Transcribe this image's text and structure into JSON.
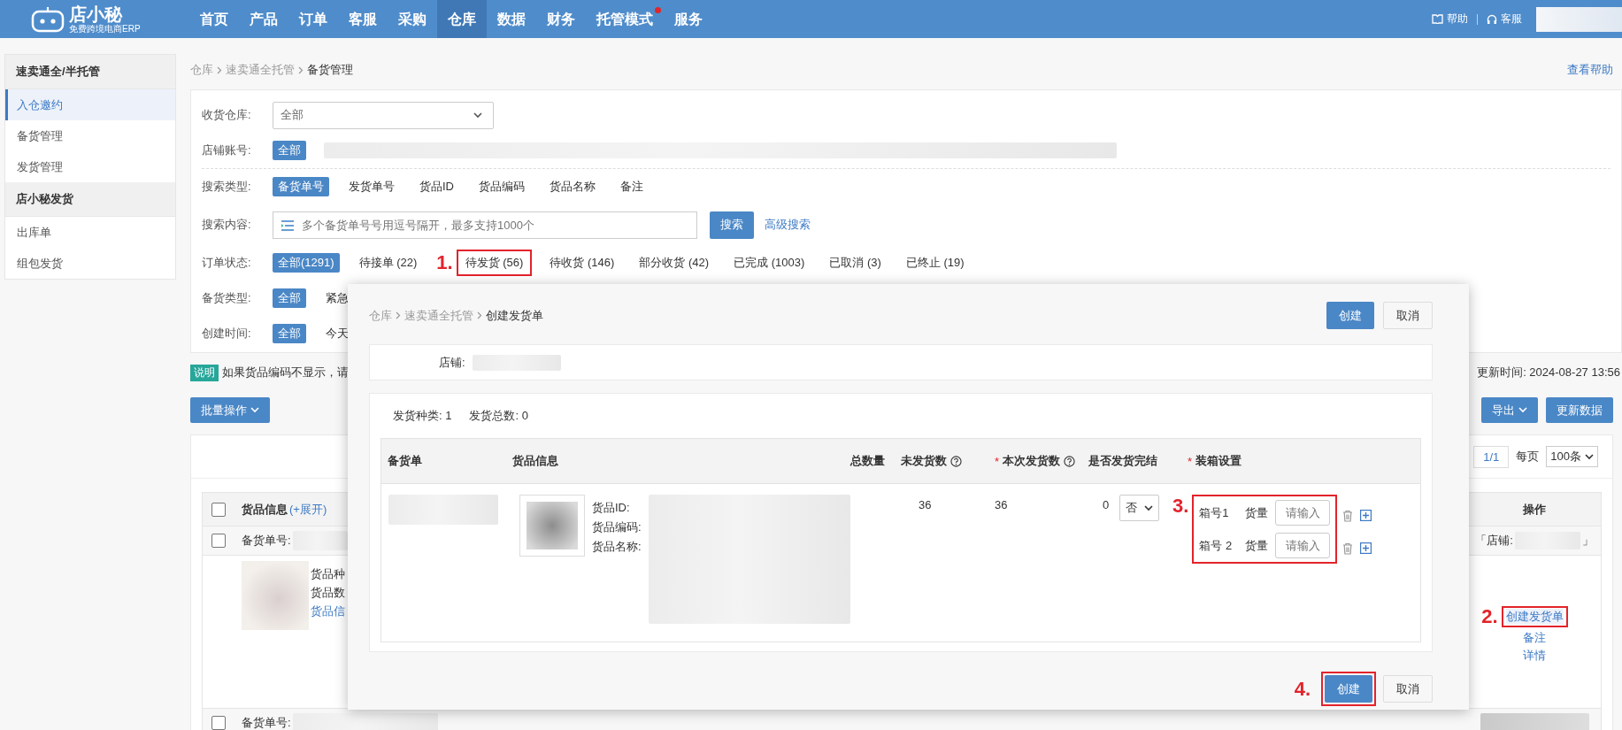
{
  "nav": {
    "brand": "店小秘",
    "brand_sub": "免费跨境电商ERP",
    "items": [
      {
        "label": "首页",
        "selected": false,
        "badge": false
      },
      {
        "label": "产品",
        "selected": false,
        "badge": false
      },
      {
        "label": "订单",
        "selected": false,
        "badge": false
      },
      {
        "label": "客服",
        "selected": false,
        "badge": false
      },
      {
        "label": "采购",
        "selected": false,
        "badge": false
      },
      {
        "label": "仓库",
        "selected": true,
        "badge": false
      },
      {
        "label": "数据",
        "selected": false,
        "badge": false
      },
      {
        "label": "财务",
        "selected": false,
        "badge": false
      },
      {
        "label": "托管模式",
        "selected": false,
        "badge": true
      },
      {
        "label": "服务",
        "selected": false,
        "badge": false
      }
    ],
    "help": "帮助",
    "service": "客服"
  },
  "sidebar": {
    "groups": [
      {
        "title": "速卖通全/半托管",
        "items": [
          {
            "label": "入仓邀约",
            "selected": true
          },
          {
            "label": "备货管理",
            "selected": false
          },
          {
            "label": "发货管理",
            "selected": false
          }
        ]
      },
      {
        "title": "店小秘发货",
        "items": [
          {
            "label": "出库单",
            "selected": false
          },
          {
            "label": "组包发货",
            "selected": false
          }
        ]
      }
    ]
  },
  "breadcrumb": [
    "仓库",
    "速卖通全托管",
    "备货管理"
  ],
  "help_link": "查看帮助",
  "filters": [
    {
      "kind": "select",
      "label": "收货仓库:",
      "value": "全部"
    },
    {
      "kind": "chips",
      "label": "店铺账号:",
      "redacted": true,
      "options": [
        {
          "label": "全部",
          "selected": true
        }
      ]
    },
    {
      "kind": "divider"
    },
    {
      "kind": "chips",
      "label": "搜索类型:",
      "redacted": false,
      "options": [
        {
          "label": "备货单号",
          "selected": true
        },
        {
          "label": "发货单号",
          "selected": false
        },
        {
          "label": "货品ID",
          "selected": false
        },
        {
          "label": "货品编码",
          "selected": false
        },
        {
          "label": "货品名称",
          "selected": false
        },
        {
          "label": "备注",
          "selected": false
        }
      ]
    },
    {
      "kind": "search",
      "label": "搜索内容:",
      "placeholder": "多个备货单号号用逗号隔开，最多支持1000个",
      "button": "搜索",
      "link": "高级搜索"
    },
    {
      "kind": "chips",
      "label": "订单状态:",
      "redacted": false,
      "options": [
        {
          "label": "全部(1291)",
          "selected": true
        },
        {
          "label": "待接单 (22)",
          "selected": false
        },
        {
          "label": "待发货 (56)",
          "selected": false,
          "annotation": "1."
        },
        {
          "label": "待收货 (146)",
          "selected": false
        },
        {
          "label": "部分收货 (42)",
          "selected": false
        },
        {
          "label": "已完成 (1003)",
          "selected": false
        },
        {
          "label": "已取消 (3)",
          "selected": false
        },
        {
          "label": "已终止 (19)",
          "selected": false
        }
      ]
    },
    {
      "kind": "chips",
      "label": "备货类型:",
      "redacted": false,
      "options": [
        {
          "label": "全部",
          "selected": true
        },
        {
          "label": "紧急",
          "selected": false
        }
      ]
    },
    {
      "kind": "chips",
      "label": "创建时间:",
      "redacted": false,
      "options": [
        {
          "label": "全部",
          "selected": true
        },
        {
          "label": "今天",
          "selected": false
        }
      ]
    }
  ],
  "notice": {
    "tag": "说明",
    "text": "如果货品编码不显示，请"
  },
  "update_time": "更新时间: 2024-08-27 13:56",
  "toolbar": {
    "batch": "批量操作",
    "export": "导出",
    "refresh": "更新数据"
  },
  "pagination": {
    "page": "1/1",
    "per_page_label": "每页",
    "per_page": "100条"
  },
  "table": {
    "header": "货品信息",
    "expand": "(+展开)",
    "header_checked": false,
    "ops_header": "操作",
    "rows": [
      {
        "checked": false,
        "order_label": "备货单号:",
        "shop_open": "「店铺:",
        "shop_close": "」",
        "summary": [
          "货品种",
          "货品数"
        ],
        "info_link": "货品信",
        "actions": [
          {
            "label": "创建发货单",
            "annotation": "2."
          },
          {
            "label": "备注"
          },
          {
            "label": "详情"
          }
        ]
      }
    ],
    "next_row": {
      "checked": false,
      "order_label": "备货单号:"
    }
  },
  "modal": {
    "breadcrumb": [
      "仓库",
      "速卖通全托管",
      "创建发货单"
    ],
    "top_buttons": [
      {
        "label": "创建",
        "kind": "primary"
      },
      {
        "label": "取消",
        "kind": "default"
      }
    ],
    "shop_label": "店铺:",
    "stats": [
      {
        "label": "发货种类:",
        "value": "1"
      },
      {
        "label": "发货总数:",
        "value": "0"
      }
    ],
    "columns": [
      {
        "label": "备货单",
        "kind": "plain"
      },
      {
        "label": "货品信息",
        "kind": "plain"
      },
      {
        "label": "总数量",
        "kind": "plain"
      },
      {
        "label": "未发货数",
        "kind": "help"
      },
      {
        "label": "本次发货数",
        "required_mark": "*",
        "kind": "help"
      },
      {
        "label": "是否发货完结",
        "kind": "plain"
      },
      {
        "label": "装箱设置",
        "required_mark": "*",
        "kind": "plain"
      }
    ],
    "rows": [
      {
        "product_labels": [
          "货品ID:",
          "货品编码:",
          "货品名称:"
        ],
        "unshipped": "36",
        "this_time": "36",
        "count": "0",
        "completed": "否",
        "boxes_annotation": "3.",
        "boxes": [
          {
            "label": "箱号1",
            "qty_label": "货量",
            "placeholder": "请输入"
          },
          {
            "label": "箱号 2",
            "qty_label": "货量",
            "placeholder": "请输入"
          }
        ]
      }
    ],
    "footer_buttons": [
      {
        "label": "创建",
        "kind": "primary",
        "annotation": "4."
      },
      {
        "label": "取消",
        "kind": "default"
      }
    ]
  }
}
